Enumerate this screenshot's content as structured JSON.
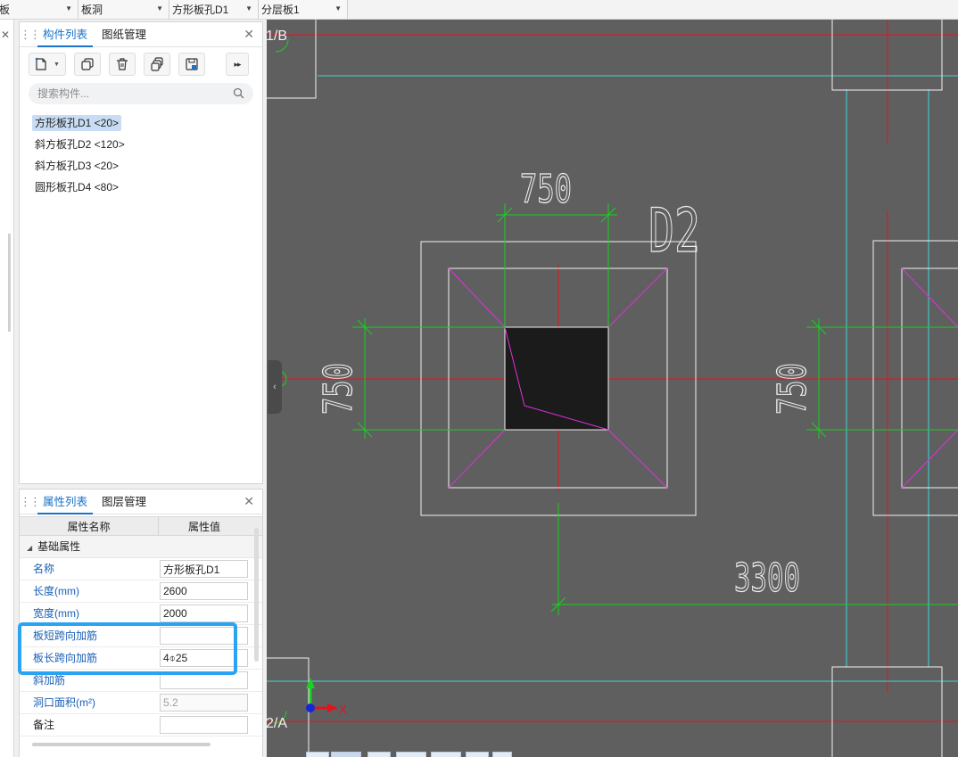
{
  "topbar": {
    "combo1": "板",
    "combo2": "板洞",
    "combo3": "方形板孔D1",
    "combo4": "分层板1"
  },
  "component_panel": {
    "tab_components": "构件列表",
    "tab_drawings": "图纸管理",
    "search_placeholder": "搜索构件...",
    "items": [
      "方形板孔D1 <20>",
      "斜方板孔D2 <120>",
      "斜方板孔D3 <20>",
      "圆形板孔D4 <80>"
    ],
    "selected_index": 0
  },
  "property_panel": {
    "tab_properties": "属性列表",
    "tab_layers": "图层管理",
    "col_name": "属性名称",
    "col_value": "属性值",
    "group_basic": "基础属性",
    "rows": [
      {
        "name": "名称",
        "value": "方形板孔D1"
      },
      {
        "name": "长度(mm)",
        "value": "2600"
      },
      {
        "name": "宽度(mm)",
        "value": "2000"
      },
      {
        "name": "板短跨向加筋",
        "value": ""
      },
      {
        "name": "板长跨向加筋",
        "value": "4⌽25"
      },
      {
        "name": "斜加筋",
        "value": ""
      },
      {
        "name": "洞口面积(m²)",
        "value": "5.2"
      },
      {
        "name": "备注",
        "value": ""
      }
    ]
  },
  "canvas": {
    "axis_top": "1/B",
    "axis_bottom": "2/A",
    "dim_top": "750",
    "label_d2": "D2",
    "dim_left": "750",
    "dim_right": "750",
    "dim_bottom": "3300",
    "ucs_x": "X",
    "colors": {
      "background": "#5f5f5f",
      "axis": "#e0141e",
      "dimension": "#19d21e",
      "outline": "#f0f0f0",
      "slope": "#e030e0",
      "cyan": "#3fd6d6"
    }
  },
  "colors": {
    "accent": "#1a72c9",
    "highlight": "#2aa3f2",
    "selected_bg": "#c8ddf4"
  }
}
